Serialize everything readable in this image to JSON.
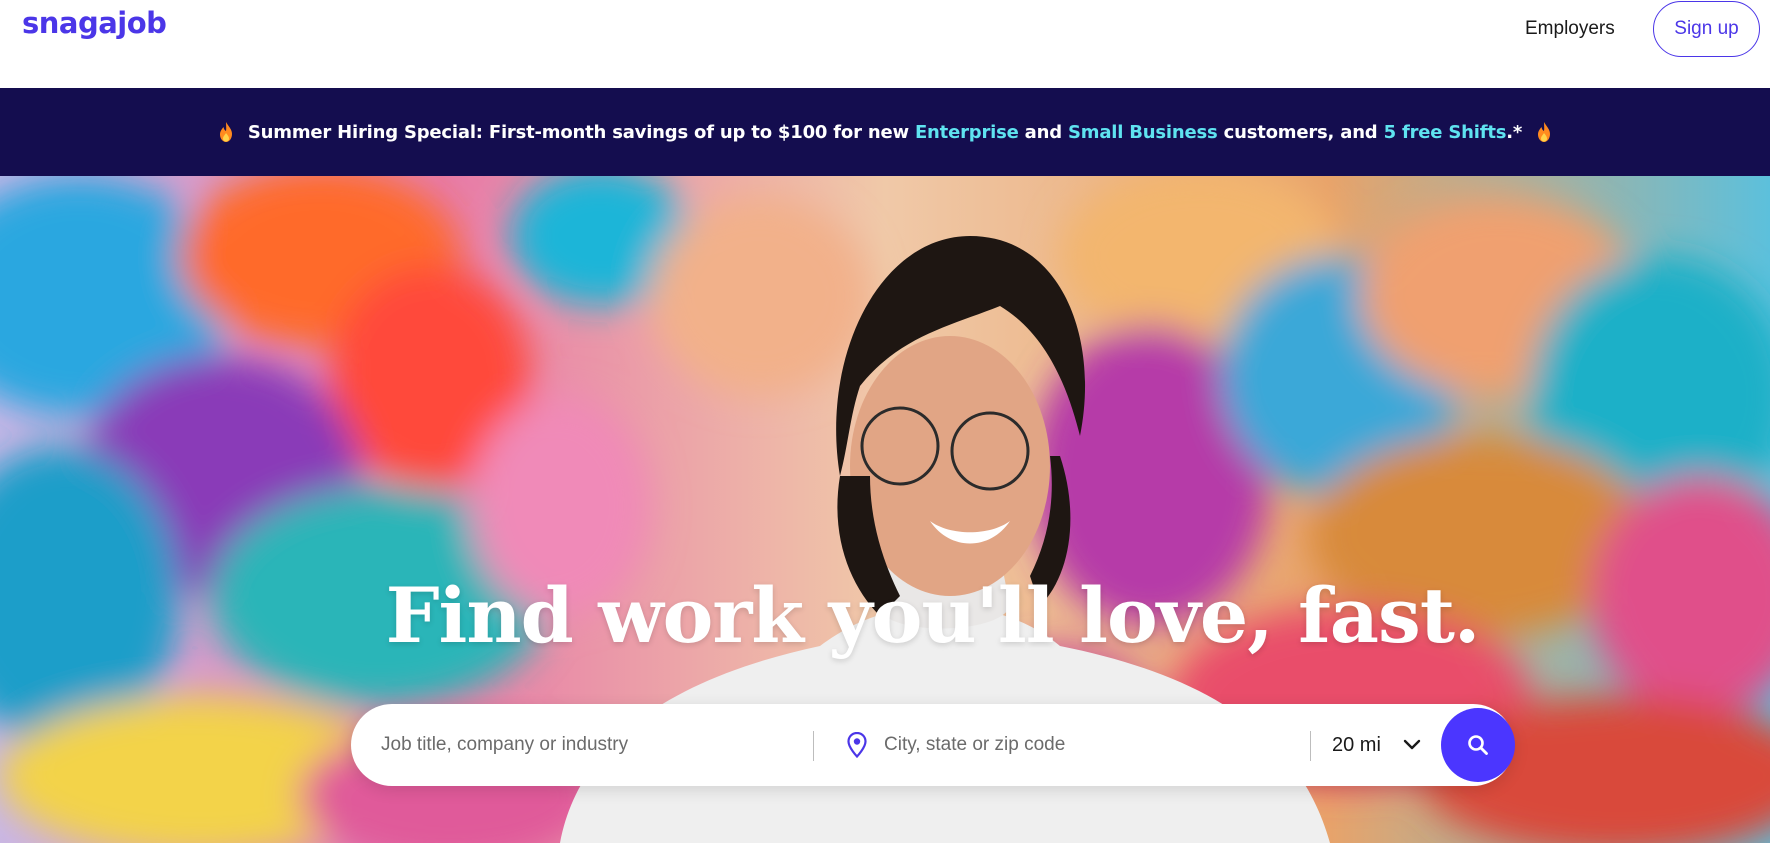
{
  "header": {
    "logo_text": "snagajob",
    "employers_label": "Employers",
    "signup_label": "Sign up"
  },
  "promo": {
    "prefix": "Summer Hiring Special: First-month savings of up to $100 for new ",
    "link_enterprise": "Enterprise",
    "and_text": " and ",
    "link_small_business": "Small Business",
    "middle_text": " customers, and ",
    "link_shifts": "5 free Shifts",
    "suffix": ".*",
    "icon": "flame-icon"
  },
  "hero": {
    "title": "Find work you'll love, fast."
  },
  "search": {
    "job_placeholder": "Job title, company or industry",
    "job_value": "",
    "location_placeholder": "City, state or zip code",
    "location_value": "",
    "radius_value": "20 mi"
  },
  "colors": {
    "brand": "#4b36e8",
    "banner_bg": "#140d4f",
    "banner_link": "#5fe3f0",
    "search_button": "#4b36ff"
  }
}
